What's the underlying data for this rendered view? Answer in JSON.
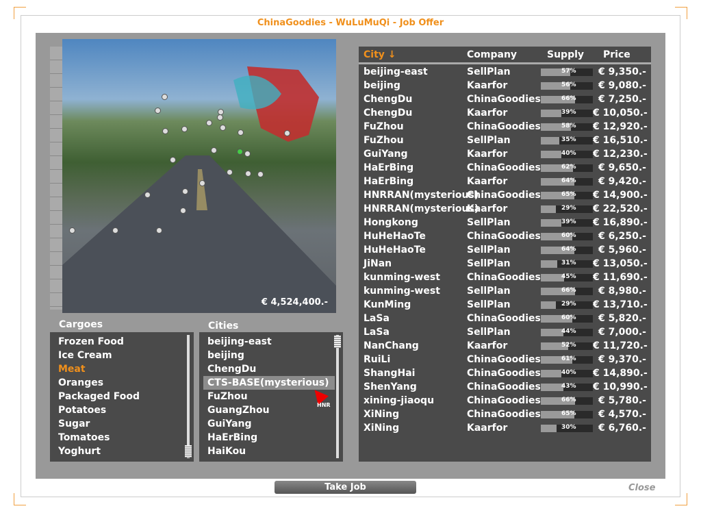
{
  "title": "ChinaGoodies - WuLuMuQi - Job Offer",
  "money": "€ 4,524,400.-",
  "cargoes": {
    "label": "Cargoes",
    "items": [
      "Frozen Food",
      "Ice Cream",
      "Meat",
      "Oranges",
      "Packaged Food",
      "Potatoes",
      "Sugar",
      "Tomatoes",
      "Yoghurt"
    ],
    "selected": 2
  },
  "cities": {
    "label": "Cities",
    "items": [
      "beijing-east",
      "beijing",
      "ChengDu",
      "CTS-BASE(mysterious)",
      "FuZhou",
      "GuangZhou",
      "GuiYang",
      "HaErBing",
      "HaiKou"
    ],
    "highlighted": 3,
    "cursor_label": "HNR"
  },
  "table": {
    "headers": {
      "city": "City ↓",
      "company": "Company",
      "supply": "Supply",
      "price": "Price"
    },
    "rows": [
      [
        "beijing-east",
        "SellPlan",
        57,
        "€ 9,350.-"
      ],
      [
        "beijing",
        "Kaarfor",
        56,
        "€ 9,080.-"
      ],
      [
        "ChengDu",
        "ChinaGoodies",
        66,
        "€ 7,250.-"
      ],
      [
        "ChengDu",
        "Kaarfor",
        39,
        "€ 10,050.-"
      ],
      [
        "FuZhou",
        "ChinaGoodies",
        58,
        "€ 12,920.-"
      ],
      [
        "FuZhou",
        "SellPlan",
        35,
        "€ 16,510.-"
      ],
      [
        "GuiYang",
        "Kaarfor",
        40,
        "€ 12,230.-"
      ],
      [
        "HaErBing",
        "ChinaGoodies",
        62,
        "€ 9,650.-"
      ],
      [
        "HaErBing",
        "Kaarfor",
        64,
        "€ 9,420.-"
      ],
      [
        "HNRRAN(mysterious)",
        "ChinaGoodies",
        65,
        "€ 14,900.-"
      ],
      [
        "HNRRAN(mysterious)",
        "Kaarfor",
        29,
        "€ 22,520.-"
      ],
      [
        "Hongkong",
        "SellPlan",
        39,
        "€ 16,890.-"
      ],
      [
        "HuHeHaoTe",
        "ChinaGoodies",
        60,
        "€ 6,250.-"
      ],
      [
        "HuHeHaoTe",
        "SellPlan",
        64,
        "€ 5,960.-"
      ],
      [
        "JiNan",
        "SellPlan",
        31,
        "€ 13,050.-"
      ],
      [
        "kunming-west",
        "ChinaGoodies",
        45,
        "€ 11,690.-"
      ],
      [
        "kunming-west",
        "SellPlan",
        66,
        "€ 8,980.-"
      ],
      [
        "KunMing",
        "SellPlan",
        29,
        "€ 13,710.-"
      ],
      [
        "LaSa",
        "ChinaGoodies",
        60,
        "€ 5,820.-"
      ],
      [
        "LaSa",
        "SellPlan",
        44,
        "€ 7,000.-"
      ],
      [
        "NanChang",
        "Kaarfor",
        52,
        "€ 11,720.-"
      ],
      [
        "RuiLi",
        "ChinaGoodies",
        61,
        "€ 9,370.-"
      ],
      [
        "ShangHai",
        "ChinaGoodies",
        40,
        "€ 14,890.-"
      ],
      [
        "ShenYang",
        "ChinaGoodies",
        43,
        "€ 10,990.-"
      ],
      [
        "xining-jiaoqu",
        "ChinaGoodies",
        66,
        "€ 5,780.-"
      ],
      [
        "XiNing",
        "ChinaGoodies",
        65,
        "€ 4,570.-"
      ],
      [
        "XiNing",
        "Kaarfor",
        30,
        "€ 6,760.-"
      ]
    ]
  },
  "buttons": {
    "take_job": "Take Job",
    "close": "Close"
  },
  "colors": {
    "accent": "#f0901c",
    "panel": "#999999",
    "list_bg": "#4a4a4a"
  }
}
